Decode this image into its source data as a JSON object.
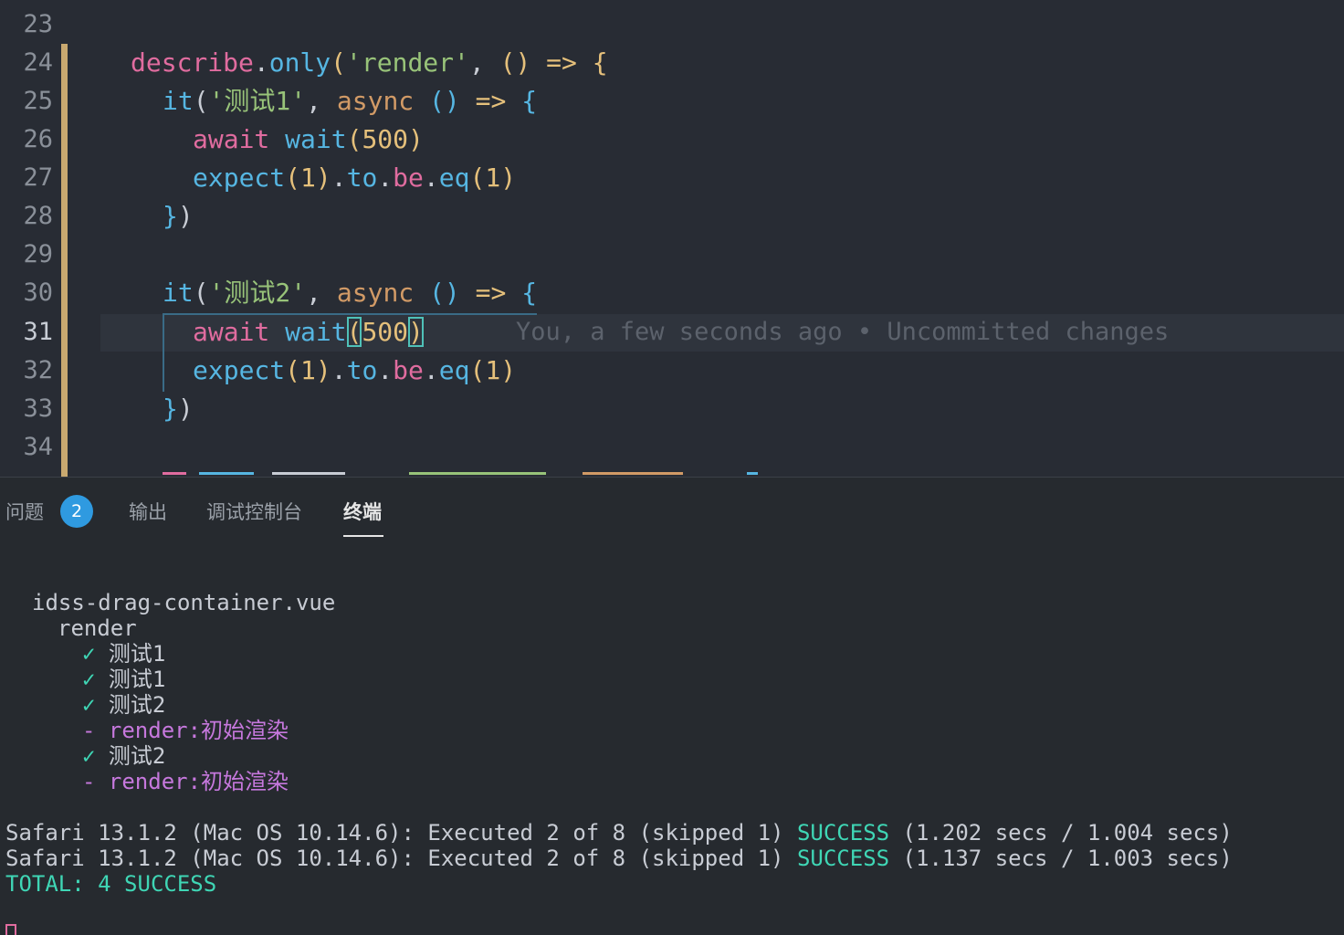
{
  "editor": {
    "line_numbers": [
      "23",
      "24",
      "25",
      "26",
      "27",
      "28",
      "29",
      "30",
      "31",
      "32",
      "33",
      "34"
    ],
    "lines": {
      "l24": {
        "describe": "describe",
        "dot": ".",
        "only": "only",
        "open": "(",
        "str": "'render'",
        "comma": ", ",
        "parens": "()",
        "arrow": " => ",
        "brace": "{"
      },
      "l25": {
        "it": "it",
        "open": "(",
        "str": "'测试1'",
        "comma": ", ",
        "async": "async",
        "parens": " ()",
        "arrow": " => ",
        "brace": "{"
      },
      "l26": {
        "await": "await",
        "wait": "wait",
        "open": "(",
        "num": "500",
        "close": ")"
      },
      "l27": {
        "expect": "expect",
        "open": "(",
        "num": "1",
        "close": ")",
        "dot1": ".",
        "to": "to",
        "dot2": ".",
        "be": "be",
        "dot3": ".",
        "eq": "eq",
        "open2": "(",
        "num2": "1",
        "close2": ")"
      },
      "l28": {
        "brace": "}",
        "paren": ")"
      },
      "l30": {
        "it": "it",
        "open": "(",
        "str": "'测试2'",
        "comma": ", ",
        "async": "async",
        "parens": " ()",
        "arrow": " => ",
        "brace": "{"
      },
      "l31": {
        "await": "await",
        "wait": "wait",
        "open": "(",
        "num": "500",
        "close": ")"
      },
      "l32": {
        "expect": "expect",
        "open": "(",
        "num": "1",
        "close": ")",
        "dot1": ".",
        "to": "to",
        "dot2": ".",
        "be": "be",
        "dot3": ".",
        "eq": "eq",
        "open2": "(",
        "num2": "1",
        "close2": ")"
      },
      "l33": {
        "brace": "}",
        "paren": ")"
      }
    },
    "blame": "You, a few seconds ago • Uncommitted changes",
    "colors": {
      "gutter_modified": "#e5c07b",
      "bracket_match": "#4fc1b8"
    }
  },
  "panel": {
    "tabs": [
      {
        "label": "问题",
        "badge": "2"
      },
      {
        "label": "输出"
      },
      {
        "label": "调试控制台"
      },
      {
        "label": "终端",
        "active": true
      }
    ],
    "terminal": {
      "file": "idss-drag-container.vue",
      "suite": "render",
      "results": [
        {
          "mark": "✓",
          "name": "测试1",
          "status": "passed"
        },
        {
          "mark": "✓",
          "name": "测试1",
          "status": "passed"
        },
        {
          "mark": "✓",
          "name": "测试2",
          "status": "passed"
        },
        {
          "mark": "-",
          "name": "render:初始渲染",
          "status": "skipped"
        },
        {
          "mark": "✓",
          "name": "测试2",
          "status": "passed"
        },
        {
          "mark": "-",
          "name": "render:初始渲染",
          "status": "skipped"
        }
      ],
      "summary": [
        {
          "prefix": "Safari 13.1.2 (Mac OS 10.14.6): Executed 2 of 8 (skipped 1) ",
          "status": "SUCCESS",
          "suffix": " (1.202 secs / 1.004 secs)"
        },
        {
          "prefix": "Safari 13.1.2 (Mac OS 10.14.6): Executed 2 of 8 (skipped 1) ",
          "status": "SUCCESS",
          "suffix": " (1.137 secs / 1.003 secs)"
        }
      ],
      "total": "TOTAL: 4 SUCCESS",
      "colors": {
        "success": "#3fd6b5",
        "skipped": "#c678dd"
      }
    }
  }
}
